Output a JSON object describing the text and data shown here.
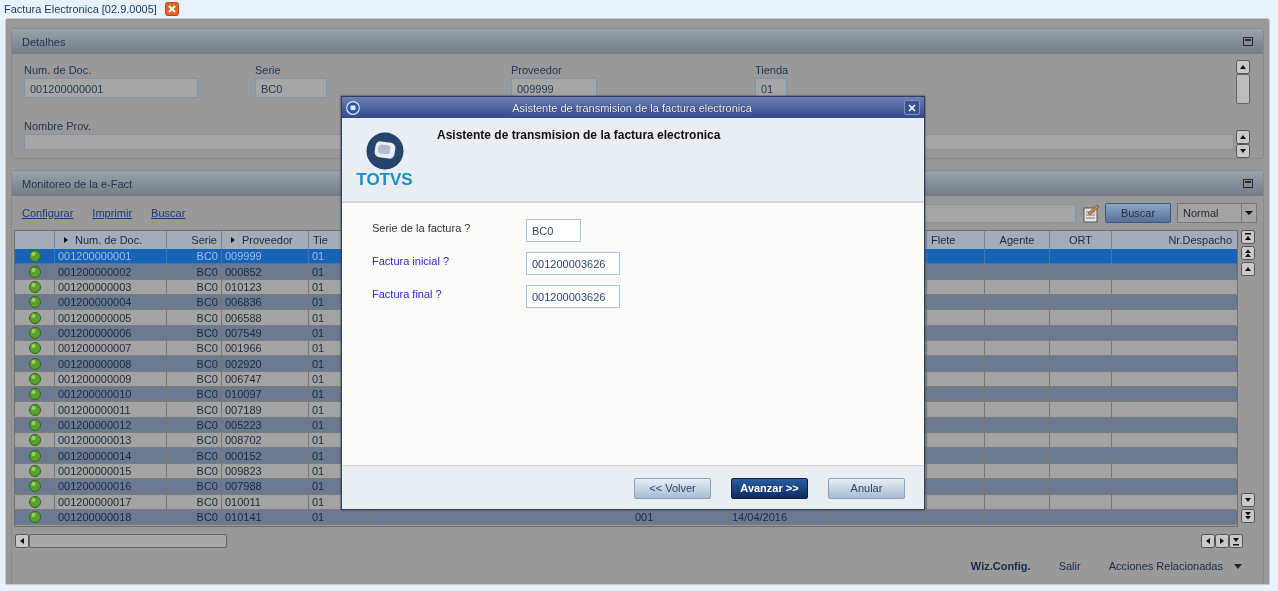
{
  "tab": {
    "label": "Factura Electronica [02.9.0005]"
  },
  "detalhes": {
    "title": "Detalhes",
    "fields": [
      {
        "label": "Num. de Doc.",
        "value": "001200000001"
      },
      {
        "label": "Serie",
        "value": "BC0"
      },
      {
        "label": "Proveedor",
        "value": "009999"
      },
      {
        "label": "Tienda",
        "value": "01"
      },
      {
        "label": "Nombre Prov."
      }
    ]
  },
  "monitor": {
    "title": "Monitoreo de la e-Fact",
    "links": [
      "Configurar",
      "Imprimir",
      "Buscar"
    ],
    "search_button": "Buscar",
    "filter": "Normal",
    "columns": [
      {
        "label": "Num. de Doc.",
        "sort_marker": true
      },
      {
        "label": "Serie",
        "sort_marker": false
      },
      {
        "label": "Proveedor",
        "sort_marker": true
      },
      {
        "label": "Tie",
        "sort_marker": false
      },
      {
        "label": "Flete",
        "sort_marker": false
      },
      {
        "label": "Agente",
        "sort_marker": false
      },
      {
        "label": "ORT",
        "sort_marker": false
      },
      {
        "label": "Nr.Despacho",
        "sort_marker": false
      }
    ],
    "rows": [
      {
        "cells": [
          "001200000001",
          "BC0",
          "009999",
          "01"
        ],
        "selected": true
      },
      {
        "cells": [
          "001200000002",
          "BC0",
          "000852",
          "01"
        ],
        "selected": false
      },
      {
        "cells": [
          "001200000003",
          "BC0",
          "010123",
          "01"
        ],
        "selected": false
      },
      {
        "cells": [
          "001200000004",
          "BC0",
          "006836",
          "01"
        ],
        "selected": false
      },
      {
        "cells": [
          "001200000005",
          "BC0",
          "006588",
          "01"
        ],
        "selected": false
      },
      {
        "cells": [
          "001200000006",
          "BC0",
          "007549",
          "01"
        ],
        "selected": false
      },
      {
        "cells": [
          "001200000007",
          "BC0",
          "001966",
          "01"
        ],
        "selected": false
      },
      {
        "cells": [
          "001200000008",
          "BC0",
          "002920",
          "01"
        ],
        "selected": false
      },
      {
        "cells": [
          "001200000009",
          "BC0",
          "006747",
          "01"
        ],
        "selected": false
      },
      {
        "cells": [
          "001200000010",
          "BC0",
          "010097",
          "01"
        ],
        "selected": false
      },
      {
        "cells": [
          "001200000011",
          "BC0",
          "007189",
          "01"
        ],
        "selected": false
      },
      {
        "cells": [
          "001200000012",
          "BC0",
          "005223",
          "01"
        ],
        "selected": false
      },
      {
        "cells": [
          "001200000013",
          "BC0",
          "008702",
          "01"
        ],
        "selected": false
      },
      {
        "cells": [
          "001200000014",
          "BC0",
          "000152",
          "01"
        ],
        "selected": false
      },
      {
        "cells": [
          "001200000015",
          "BC0",
          "009823",
          "01"
        ],
        "selected": false
      },
      {
        "cells": [
          "001200000016",
          "BC0",
          "007988",
          "01"
        ],
        "selected": false
      },
      {
        "cells": [
          "001200000017",
          "BC0",
          "010011",
          "01"
        ],
        "selected": false
      },
      {
        "cells": [
          "001200000018",
          "BC0",
          "010141",
          "01"
        ],
        "column_7": "001",
        "column_8": "14/04/2016",
        "selected": false
      }
    ]
  },
  "footer": [
    "Wiz.Config.",
    "Salir",
    "Acciones Relacionadas"
  ],
  "dialog": {
    "title": "Asistente de transmision de la factura electronica",
    "heading": "Asistente de transmision de la factura electronica",
    "logo_text": "TOTVS",
    "fields": [
      {
        "label": "Serie de la factura ?",
        "value": "BC0",
        "highlighted": false
      },
      {
        "label": "Factura inicial ?",
        "value": "001200003626",
        "highlighted": true
      },
      {
        "label": "Factura final ?",
        "value": "001200003626",
        "highlighted": true
      }
    ],
    "buttons": [
      {
        "label": "<< Volver",
        "primary": false
      },
      {
        "label": "Avanzar >>",
        "primary": true
      },
      {
        "label": "Anular",
        "primary": false
      }
    ]
  }
}
